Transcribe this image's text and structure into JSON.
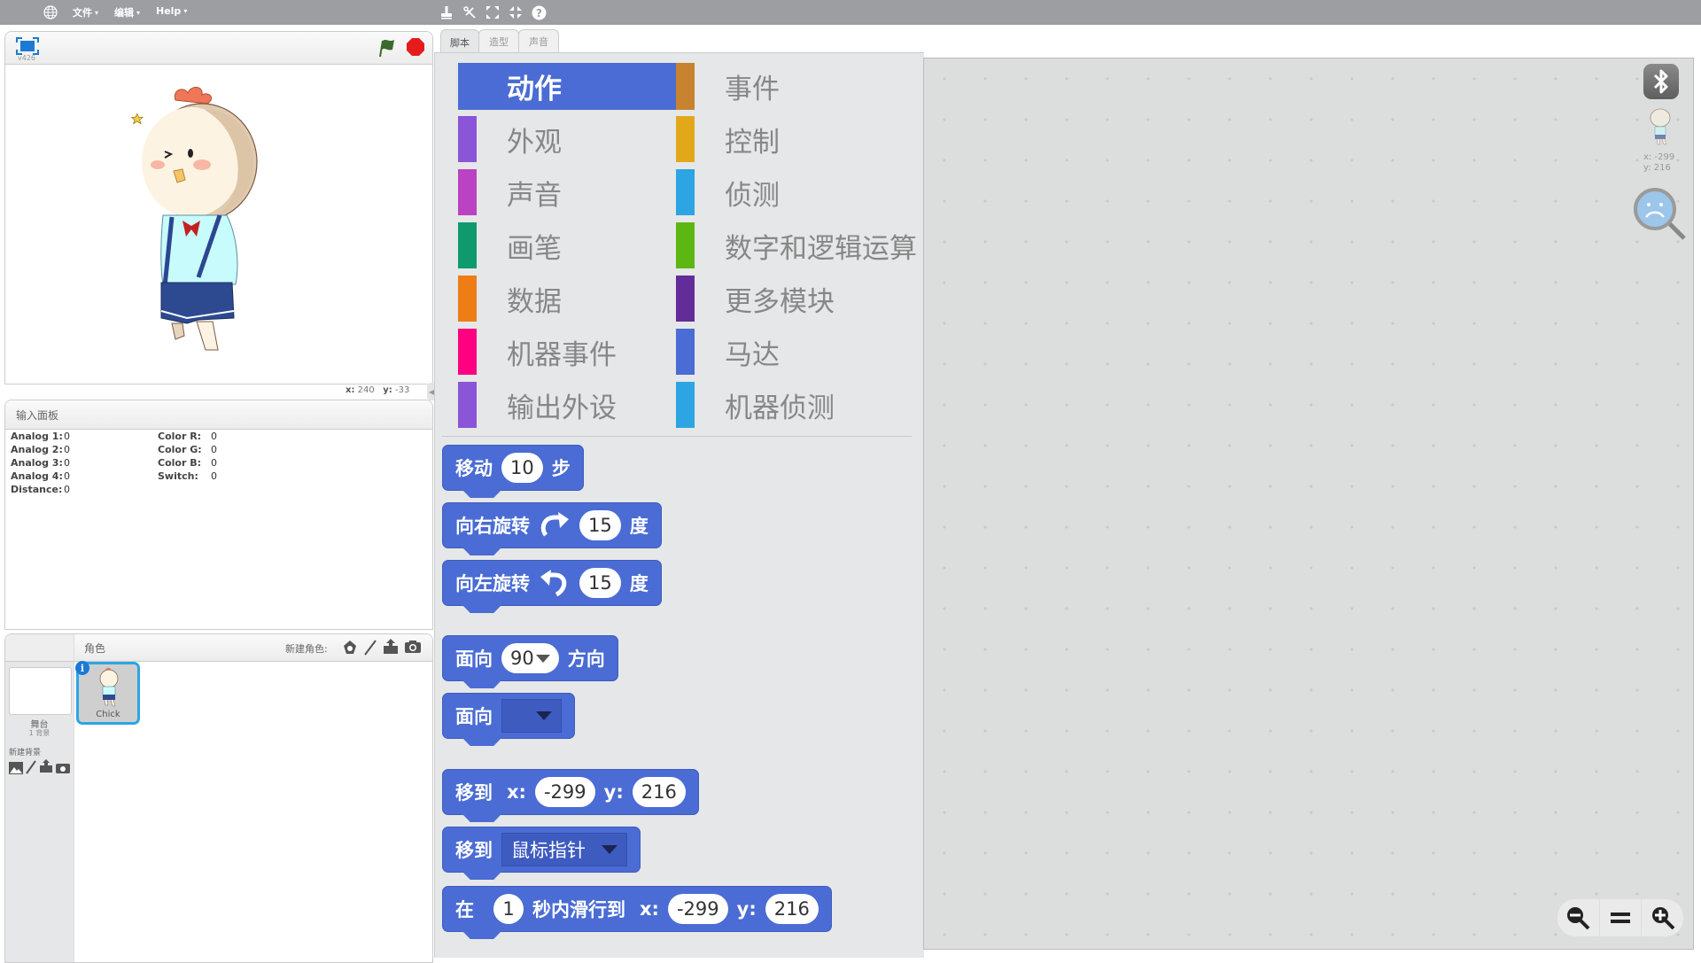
{
  "menubar": {
    "language_icon": "globe-icon",
    "menus": [
      {
        "label": "文件",
        "arrow": "▾"
      },
      {
        "label": "编辑",
        "arrow": "▾"
      },
      {
        "label": "Help",
        "arrow": "▾"
      }
    ],
    "tools": [
      "stamp-icon",
      "scissors-icon",
      "grow-icon",
      "shrink-icon",
      "help-icon"
    ]
  },
  "stage": {
    "version": "v426",
    "fullscreen_icon": "fullscreen-icon",
    "green_flag_icon": "green-flag-icon",
    "stop_icon": "stop-sign-icon",
    "mouse_x_label": "x:",
    "mouse_x": "240",
    "mouse_y_label": "y:",
    "mouse_y": "-33",
    "sprite_name": "Chick"
  },
  "input_panel": {
    "title": "输入面板",
    "left": [
      {
        "label": "Analog 1:",
        "value": "0"
      },
      {
        "label": "Analog 2:",
        "value": "0"
      },
      {
        "label": "Analog 3:",
        "value": "0"
      },
      {
        "label": "Analog 4:",
        "value": "0"
      },
      {
        "label": "Distance:",
        "value": "0"
      }
    ],
    "right": [
      {
        "label": "Color R:",
        "value": "0"
      },
      {
        "label": "Color G:",
        "value": "0"
      },
      {
        "label": "Color B:",
        "value": "0"
      },
      {
        "label": "Switch:",
        "value": "0"
      }
    ]
  },
  "sprites": {
    "title": "角色",
    "new_sprite_label": "新建角色:",
    "stage_label": "舞台",
    "stage_backdrops": "1 背景",
    "new_backdrop_label": "新建背景",
    "items": [
      {
        "name": "Chick",
        "selected": true
      }
    ]
  },
  "tabs": [
    {
      "label": "脚本",
      "active": true
    },
    {
      "label": "造型",
      "active": false
    },
    {
      "label": "声音",
      "active": false
    }
  ],
  "categories": {
    "left": [
      {
        "label": "动作",
        "color": "#4a6cd4",
        "selected": true
      },
      {
        "label": "外观",
        "color": "#8a55d7"
      },
      {
        "label": "声音",
        "color": "#bb42c3"
      },
      {
        "label": "画笔",
        "color": "#0e9a6c"
      },
      {
        "label": "数据",
        "color": "#ee7d16"
      },
      {
        "label": "机器事件",
        "color": "#ff0080"
      },
      {
        "label": "输出外设",
        "color": "#8a55d7"
      }
    ],
    "right": [
      {
        "label": "事件",
        "color": "#c88330"
      },
      {
        "label": "控制",
        "color": "#e1a91a"
      },
      {
        "label": "侦测",
        "color": "#2ca5e2"
      },
      {
        "label": "数字和逻辑运算",
        "color": "#5cb712"
      },
      {
        "label": "更多模块",
        "color": "#632d99"
      },
      {
        "label": "马达",
        "color": "#4a6cd4"
      },
      {
        "label": "机器侦测",
        "color": "#2ca5e2"
      }
    ]
  },
  "blocks": {
    "move": {
      "prefix": "移动",
      "steps": "10",
      "suffix": "步"
    },
    "turn_right": {
      "prefix": "向右旋转",
      "degrees": "15",
      "suffix": "度"
    },
    "turn_left": {
      "prefix": "向左旋转",
      "degrees": "15",
      "suffix": "度"
    },
    "point_direction": {
      "prefix": "面向",
      "value": "90",
      "suffix": "方向"
    },
    "point_towards": {
      "prefix": "面向",
      "value": ""
    },
    "go_to_xy": {
      "prefix": "移到",
      "x_label": "x:",
      "x": "-299",
      "y_label": "y:",
      "y": "216"
    },
    "go_to": {
      "prefix": "移到",
      "target": "鼠标指针"
    },
    "glide": {
      "prefix": "在",
      "secs": "1",
      "middle": "秒内滑行到",
      "x_label": "x:",
      "x": "-299",
      "y_label": "y:",
      "y": "216"
    }
  },
  "script_area": {
    "bluetooth_icon": "bluetooth-icon",
    "sprite_x_label": "x:",
    "sprite_x": "-299",
    "sprite_y_label": "y:",
    "sprite_y": "216",
    "zoom_out_icon": "zoom-out-icon",
    "zoom_reset_icon": "zoom-reset-icon",
    "zoom_in_icon": "zoom-in-icon"
  }
}
